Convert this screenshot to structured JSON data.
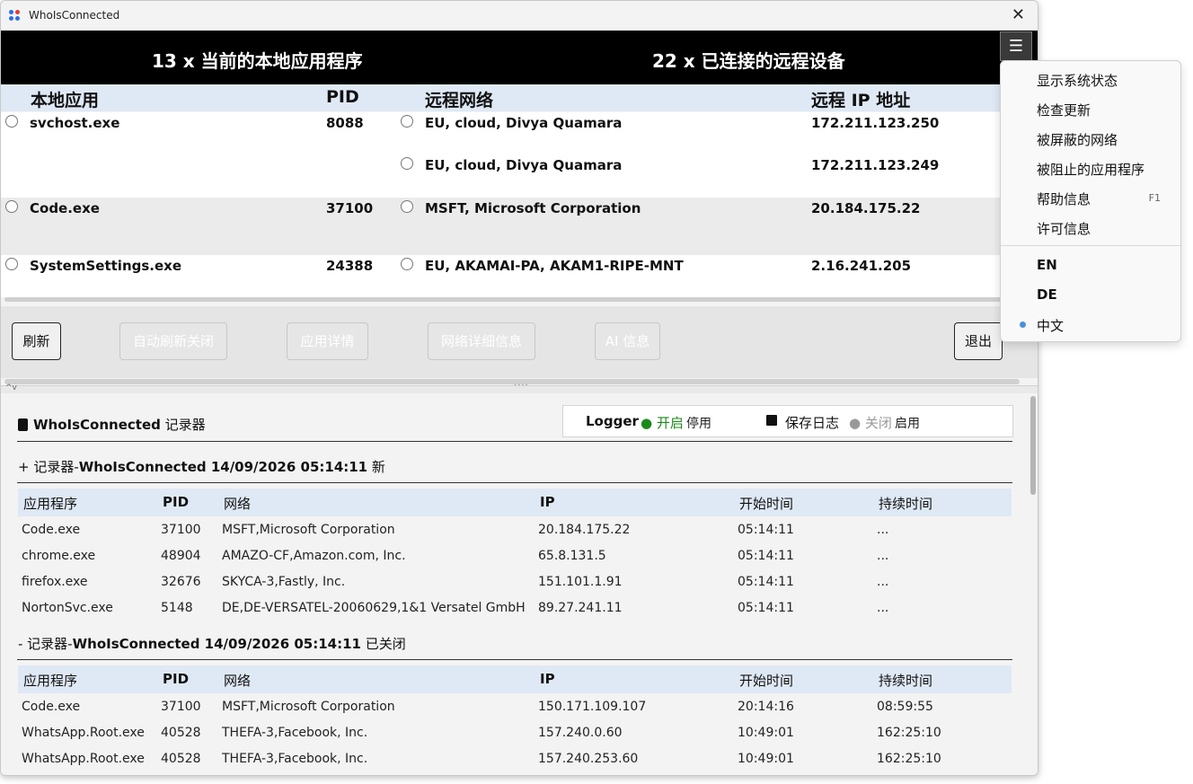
{
  "window": {
    "title": "WhoIsConnected",
    "close_glyph": "✕"
  },
  "header": {
    "local_count": "13 x 当前的本地应用程序",
    "remote_count": "22 x 已连接的远程设备",
    "menu_glyph": "☰"
  },
  "columns": {
    "local_app": "本地应用",
    "pid": "PID",
    "remote_net": "远程网络",
    "remote_ip": "远程 IP 地址"
  },
  "connections": [
    {
      "app": "svchost.exe",
      "pid": "8088",
      "net": "EU, cloud, Divya Quamara",
      "ip": "172.211.123.250"
    },
    {
      "net": "EU, cloud, Divya Quamara",
      "ip": "172.211.123.249"
    },
    {
      "app": "Code.exe",
      "pid": "37100",
      "net": "MSFT, Microsoft Corporation",
      "ip": "20.184.175.22"
    },
    {
      "app": "SystemSettings.exe",
      "pid": "24388",
      "net": "EU, AKAMAI-PA, AKAM1-RIPE-MNT",
      "ip": "2.16.241.205"
    }
  ],
  "buttons": {
    "refresh": "刷新",
    "auto_refresh": "自动刷新关闭",
    "app_details": "应用详情",
    "net_details": "网络详细信息",
    "ai_info": "AI 信息",
    "exit": "退出"
  },
  "logger": {
    "title_bold": "WhoIsConnected",
    "title_rest": "记录器",
    "label": "Logger",
    "state_on": "● 开启",
    "action_disable": "停用",
    "save_log": "保存日志",
    "state_off": "● 关闭",
    "action_enable": "启用",
    "table_headers": [
      "应用程序",
      "PID",
      "网络",
      "IP",
      "开始时间",
      "持续时间"
    ],
    "sessions": [
      {
        "prefix": "+ 记录器-",
        "bold": "WhoIsConnected 14/09/2026 05:14:11",
        "suffix": " 新",
        "rows": [
          [
            "Code.exe",
            "37100",
            "MSFT,Microsoft Corporation",
            "20.184.175.22",
            "05:14:11",
            "..."
          ],
          [
            "chrome.exe",
            "48904",
            "AMAZO-CF,Amazon.com, Inc.",
            "65.8.131.5",
            "05:14:11",
            "..."
          ],
          [
            "firefox.exe",
            "32676",
            "SKYCA-3,Fastly, Inc.",
            "151.101.1.91",
            "05:14:11",
            "..."
          ],
          [
            "NortonSvc.exe",
            "5148",
            "DE,DE-VERSATEL-20060629,1&1 Versatel GmbH",
            "89.27.241.11",
            "05:14:11",
            "..."
          ]
        ]
      },
      {
        "prefix": "- 记录器-",
        "bold": "WhoIsConnected 14/09/2026 05:14:11",
        "suffix": " 已关闭",
        "rows": [
          [
            "Code.exe",
            "37100",
            "MSFT,Microsoft Corporation",
            "150.171.109.107",
            "20:14:16",
            "08:59:55"
          ],
          [
            "WhatsApp.Root.exe",
            "40528",
            "THEFA-3,Facebook, Inc.",
            "157.240.0.60",
            "10:49:01",
            "162:25:10"
          ],
          [
            "WhatsApp.Root.exe",
            "40528",
            "THEFA-3,Facebook, Inc.",
            "157.240.253.60",
            "10:49:01",
            "162:25:10"
          ]
        ]
      }
    ]
  },
  "menu": {
    "items": [
      {
        "label": "显示系统状态"
      },
      {
        "label": "检查更新"
      },
      {
        "label": "被屏蔽的网络"
      },
      {
        "label": "被阻止的应用程序"
      },
      {
        "label": "帮助信息",
        "shortcut": "F1"
      },
      {
        "label": "许可信息"
      }
    ],
    "languages": [
      {
        "label": "EN",
        "selected": false
      },
      {
        "label": "DE",
        "selected": false
      },
      {
        "label": "中文",
        "selected": true
      }
    ]
  },
  "colors": {
    "header_bg": "#000000",
    "column_header_bg": "#dfe9f5",
    "logger_on": "#1a8a1a",
    "selected_dot": "#4a90d9"
  }
}
